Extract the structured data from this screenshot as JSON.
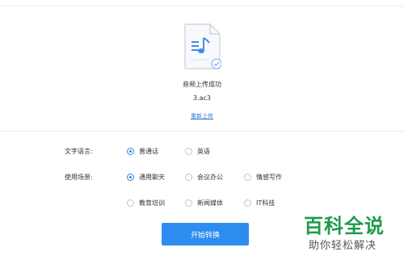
{
  "upload": {
    "status": "音频上传成功",
    "file_name": "3.ac3",
    "reupload_label": "重新上传"
  },
  "settings": {
    "language_label": "文字语言:",
    "language_options": [
      "普通话",
      "英语"
    ],
    "language_selected": "普通话",
    "scene_label": "使用场景:",
    "scene_options": [
      "通用聊天",
      "会议办公",
      "情感写作",
      "教育培训",
      "新闻媒体",
      "IT科技"
    ],
    "scene_selected": "通用聊天"
  },
  "actions": {
    "start_label": "开始转换"
  },
  "watermark": {
    "title": "百科全说",
    "subtitle": "助你轻松解决"
  },
  "colors": {
    "accent": "#2c8cf0",
    "link": "#2b7bdc",
    "watermark_green": "#1f9b4a"
  },
  "icons": {
    "file": "audio-file-icon",
    "check": "check-circle-icon"
  }
}
